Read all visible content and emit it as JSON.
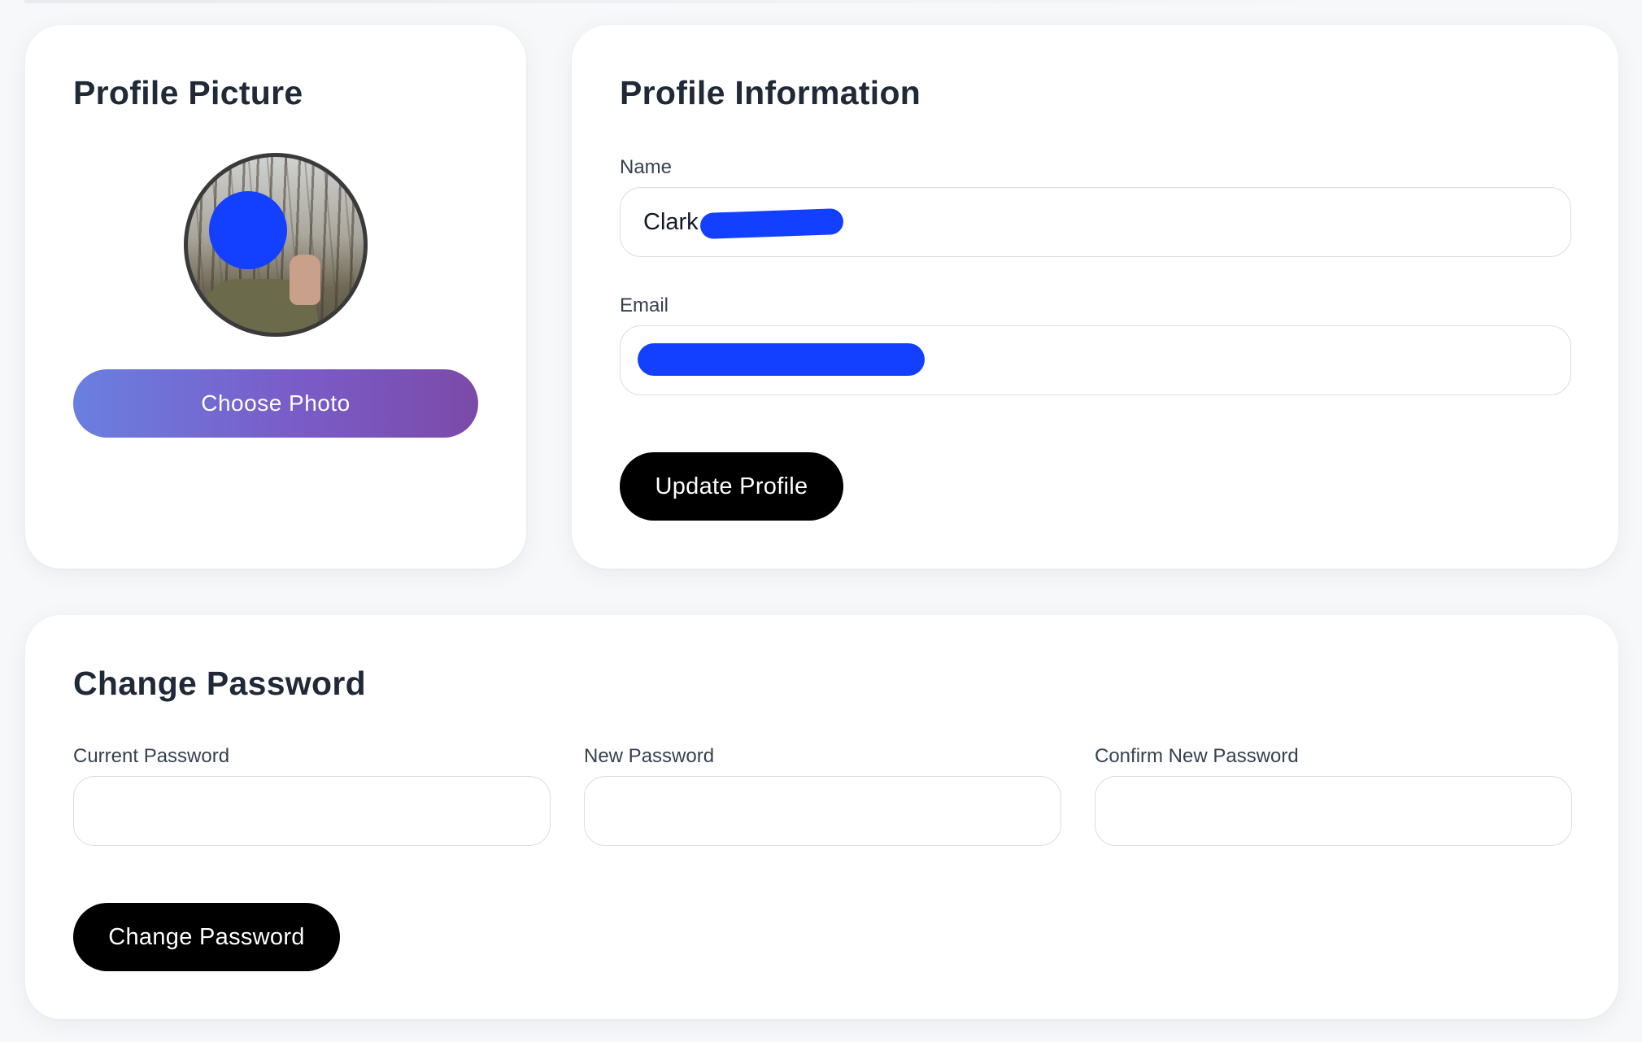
{
  "profile_picture": {
    "title": "Profile Picture",
    "choose_photo_label": "Choose Photo"
  },
  "profile_information": {
    "title": "Profile Information",
    "name_label": "Name",
    "name_value": "Clark",
    "email_label": "Email",
    "email_value": "",
    "update_button_label": "Update Profile"
  },
  "change_password": {
    "title": "Change Password",
    "current_password_label": "Current Password",
    "new_password_label": "New Password",
    "confirm_password_label": "Confirm New Password",
    "submit_button_label": "Change Password"
  },
  "colors": {
    "primary_button": "#000000",
    "choose_photo_gradient_start": "#6a7fe0",
    "choose_photo_gradient_end": "#7b4aa8",
    "redaction": "#1340ff"
  }
}
